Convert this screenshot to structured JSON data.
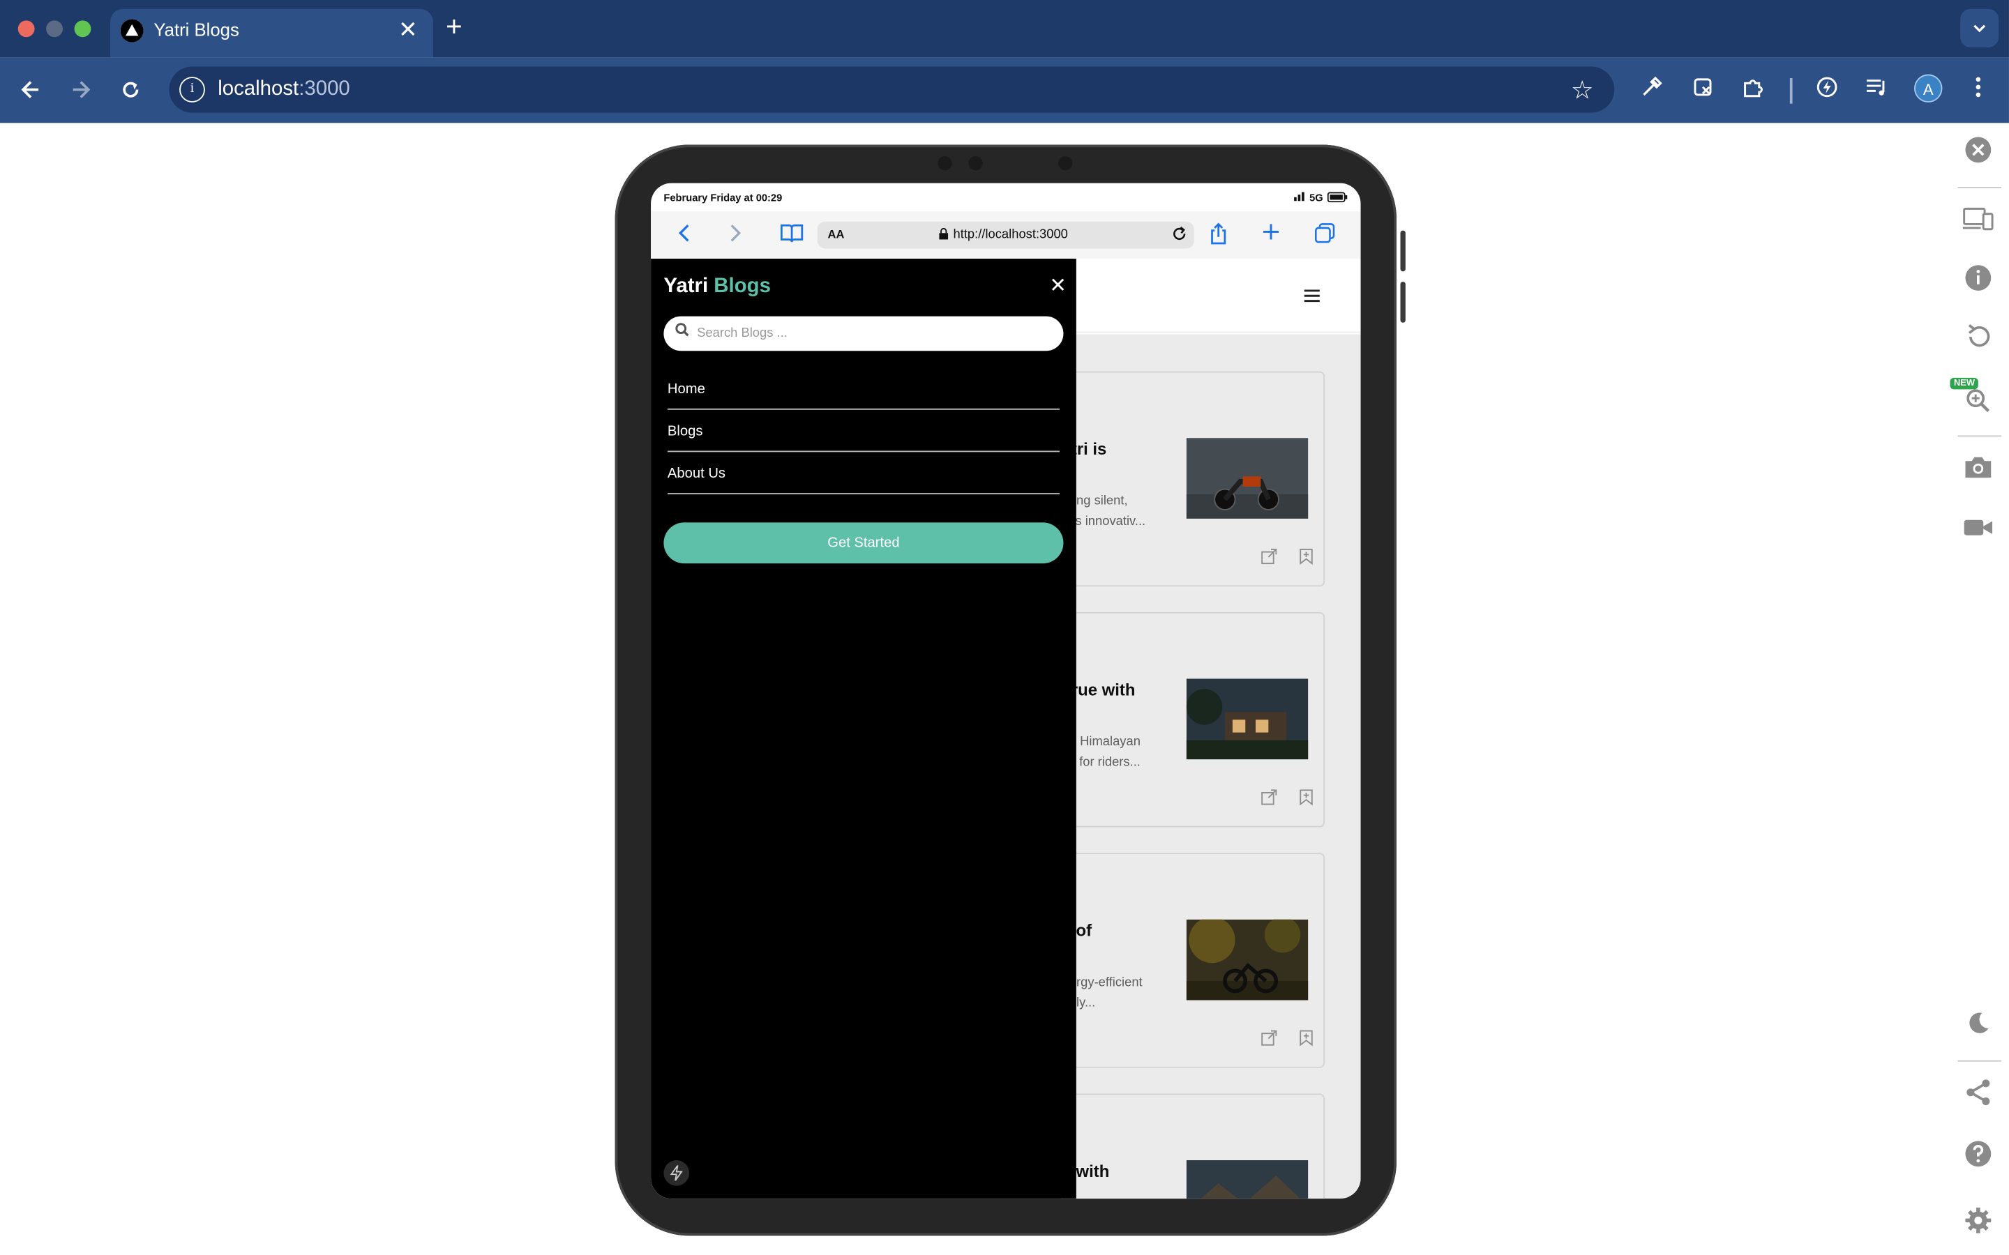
{
  "browser": {
    "tab_title": "Yatri Blogs",
    "tab_close": "✕",
    "new_tab": "+",
    "tab_menu": "⌄",
    "url_host": "localhost",
    "url_port": ":3000",
    "profile_initial": "A",
    "colors": {
      "tabbar": "#1e3a68",
      "toolbar": "#2d5086",
      "accent": "#5ec0a8"
    }
  },
  "devtools": {
    "new_badge": "NEW"
  },
  "device": {
    "status_time": "February Friday at 00:29",
    "signal": "5G",
    "safari_aa": "AA",
    "safari_url": "http://localhost:3000"
  },
  "drawer": {
    "brand_first": "Yatri",
    "brand_second": "Blogs",
    "close": "✕",
    "search_placeholder": "Search Blogs ...",
    "nav": [
      {
        "label": "Home"
      },
      {
        "label": "Blogs"
      },
      {
        "label": "About Us"
      }
    ],
    "cta": "Get Started"
  },
  "cards": [
    {
      "title_visible": "atri is",
      "desc_line1": "ering silent,",
      "desc_line2": "tri's innovativ...",
      "image": "motorcycle"
    },
    {
      "title_visible": "True with",
      "desc_line1": "he Himalayan",
      "desc_line2": "ay for riders...",
      "image": "house-at-dusk"
    },
    {
      "title_visible": "e of",
      "desc_line1": "nergy-efficient",
      "desc_line2": "ndly...",
      "image": "bike-in-forest"
    },
    {
      "title_visible": "s with",
      "image": "mountain-scene"
    }
  ]
}
